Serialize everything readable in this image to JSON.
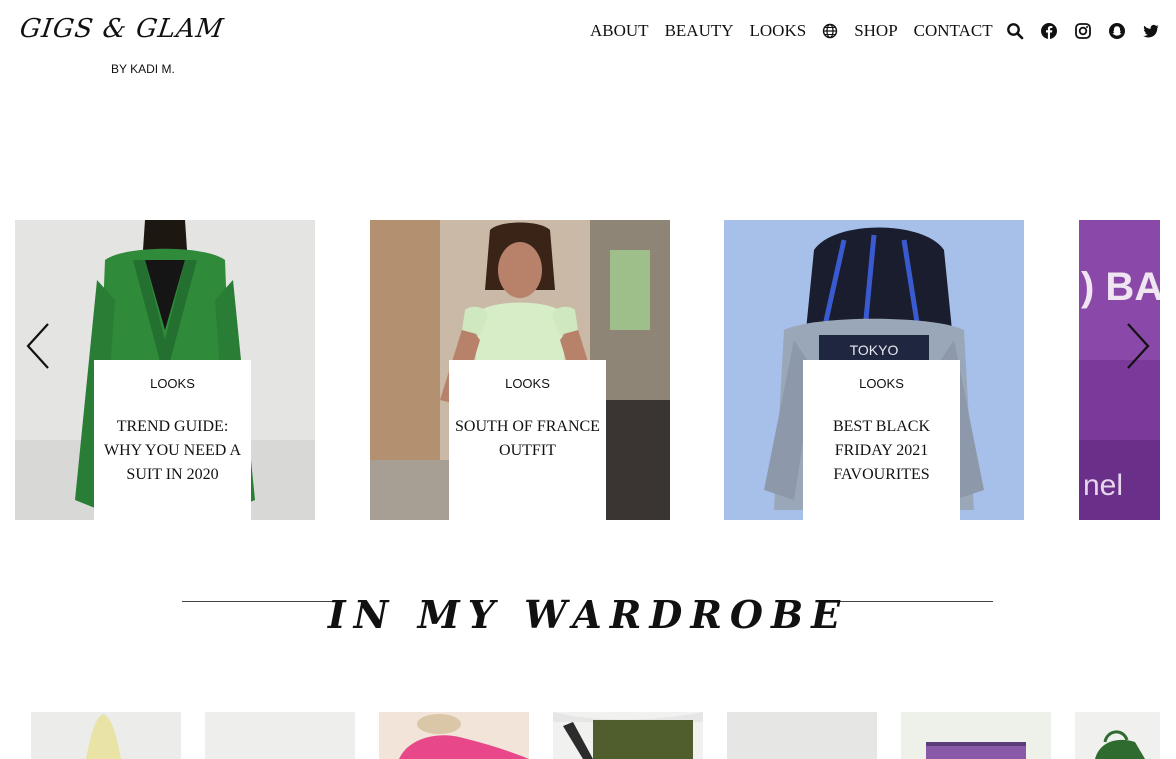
{
  "header": {
    "logo": "GIGS & GLAM",
    "byline": "BY KADI M."
  },
  "nav": {
    "items": [
      "ABOUT",
      "BEAUTY",
      "LOOKS",
      "SHOP",
      "CONTACT"
    ]
  },
  "social": [
    "search-icon",
    "facebook-icon",
    "instagram-icon",
    "snapchat-icon",
    "twitter-icon"
  ],
  "carousel": {
    "slides": [
      {
        "category": "LOOKS",
        "title": "TREND GUIDE: WHY YOU NEED A SUIT IN 2020"
      },
      {
        "category": "LOOKS",
        "title": "SOUTH OF FRANCE OUTFIT"
      },
      {
        "category": "LOOKS",
        "title": "BEST BLACK FRIDAY 2021 FAVOURITES"
      }
    ]
  },
  "wardrobe": {
    "heading": "In My Wardrobe"
  },
  "colors": {
    "text": "#111111",
    "background": "#ffffff"
  }
}
